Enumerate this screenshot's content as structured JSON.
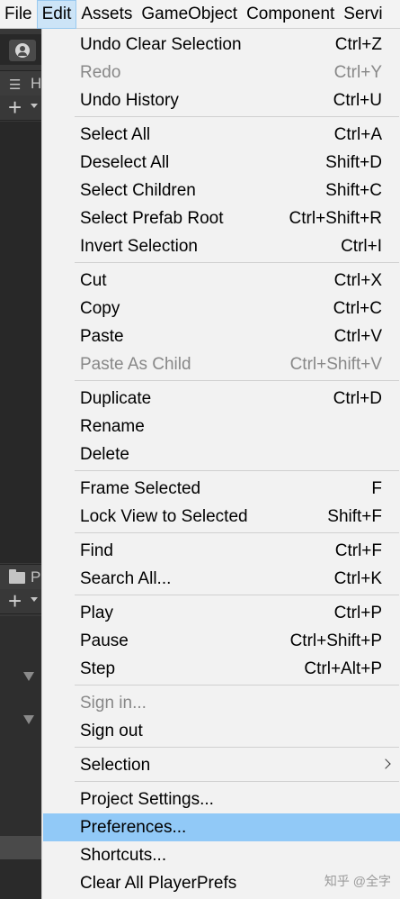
{
  "menubar": {
    "items": [
      {
        "label": "File"
      },
      {
        "label": "Edit"
      },
      {
        "label": "Assets"
      },
      {
        "label": "GameObject"
      },
      {
        "label": "Component"
      },
      {
        "label": "Servi"
      }
    ]
  },
  "editor": {
    "hierarchy_tab_label": "H",
    "project_tab_label": "P"
  },
  "edit_menu": {
    "items": [
      {
        "label": "Undo Clear Selection",
        "shortcut": "Ctrl+Z"
      },
      {
        "label": "Redo",
        "shortcut": "Ctrl+Y"
      },
      {
        "label": "Undo History",
        "shortcut": "Ctrl+U"
      },
      {
        "label": "Select All",
        "shortcut": "Ctrl+A"
      },
      {
        "label": "Deselect All",
        "shortcut": "Shift+D"
      },
      {
        "label": "Select Children",
        "shortcut": "Shift+C"
      },
      {
        "label": "Select Prefab Root",
        "shortcut": "Ctrl+Shift+R"
      },
      {
        "label": "Invert Selection",
        "shortcut": "Ctrl+I"
      },
      {
        "label": "Cut",
        "shortcut": "Ctrl+X"
      },
      {
        "label": "Copy",
        "shortcut": "Ctrl+C"
      },
      {
        "label": "Paste",
        "shortcut": "Ctrl+V"
      },
      {
        "label": "Paste As Child",
        "shortcut": "Ctrl+Shift+V"
      },
      {
        "label": "Duplicate",
        "shortcut": "Ctrl+D"
      },
      {
        "label": "Rename"
      },
      {
        "label": "Delete"
      },
      {
        "label": "Frame Selected",
        "shortcut": "F"
      },
      {
        "label": "Lock View to Selected",
        "shortcut": "Shift+F"
      },
      {
        "label": "Find",
        "shortcut": "Ctrl+F"
      },
      {
        "label": "Search All...",
        "shortcut": "Ctrl+K"
      },
      {
        "label": "Play",
        "shortcut": "Ctrl+P"
      },
      {
        "label": "Pause",
        "shortcut": "Ctrl+Shift+P"
      },
      {
        "label": "Step",
        "shortcut": "Ctrl+Alt+P"
      },
      {
        "label": "Sign in..."
      },
      {
        "label": "Sign out"
      },
      {
        "label": "Selection"
      },
      {
        "label": "Project Settings..."
      },
      {
        "label": "Preferences..."
      },
      {
        "label": "Shortcuts..."
      },
      {
        "label": "Clear All PlayerPrefs"
      }
    ]
  },
  "watermark": "知乎 @全字",
  "colors": {
    "menu_background": "#f2f2f2",
    "highlight": "#91c9f7",
    "disabled_text": "#888888",
    "editor_dark": "#383838"
  }
}
